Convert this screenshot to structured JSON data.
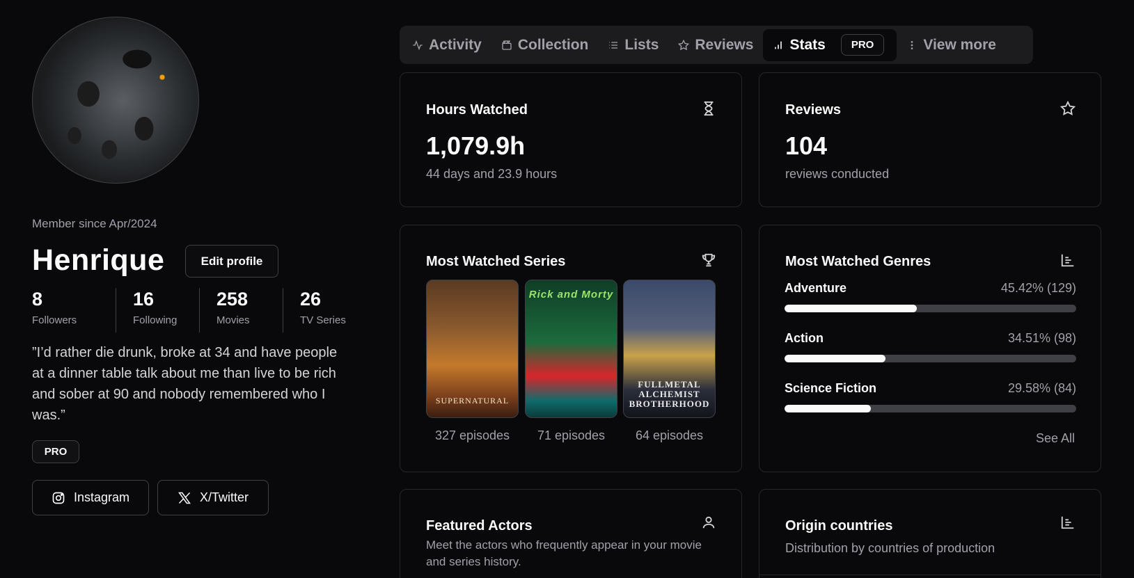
{
  "profile": {
    "member_since": "Member since Apr/2024",
    "name": "Henrique",
    "edit_label": "Edit profile",
    "stats": [
      {
        "value": "8",
        "label": "Followers"
      },
      {
        "value": "16",
        "label": "Following"
      },
      {
        "value": "258",
        "label": "Movies"
      },
      {
        "value": "26",
        "label": "TV Series"
      }
    ],
    "quote": "”I’d rather die drunk, broke at 34 and have people at a dinner table talk about me than live to be rich and sober at 90 and nobody remembered who I was.”",
    "badge": "PRO",
    "socials": [
      {
        "label": "Instagram",
        "icon": "instagram-icon"
      },
      {
        "label": "X/Twitter",
        "icon": "x-twitter-icon"
      }
    ]
  },
  "tabs": [
    {
      "label": "Activity",
      "icon": "activity-icon"
    },
    {
      "label": "Collection",
      "icon": "collection-icon"
    },
    {
      "label": "Lists",
      "icon": "list-icon"
    },
    {
      "label": "Reviews",
      "icon": "star-icon"
    },
    {
      "label": "Stats",
      "icon": "bar-chart-icon",
      "badge": "PRO",
      "active": true
    },
    {
      "label": "View more",
      "icon": "more-vertical-icon"
    }
  ],
  "hours": {
    "title": "Hours Watched",
    "value": "1,079.9h",
    "sub": "44 days and 23.9 hours",
    "icon": "hourglass-icon"
  },
  "reviews": {
    "title": "Reviews",
    "value": "104",
    "sub": "reviews conducted",
    "icon": "star-icon"
  },
  "series": {
    "title": "Most Watched Series",
    "icon": "trophy-icon",
    "items": [
      {
        "poster_text": "SUPERNATURAL",
        "episodes": "327 episodes"
      },
      {
        "poster_text": "Rick and Morty",
        "episodes": "71 episodes"
      },
      {
        "poster_text": "FULLMETAL ALCHEMIST BROTHERHOOD",
        "episodes": "64 episodes"
      }
    ]
  },
  "genres": {
    "title": "Most Watched Genres",
    "icon": "bar-chart-icon",
    "items": [
      {
        "name": "Adventure",
        "value": "45.42% (129)",
        "fraction": 0.4542
      },
      {
        "name": "Action",
        "value": "34.51% (98)",
        "fraction": 0.3451
      },
      {
        "name": "Science Fiction",
        "value": "29.58% (84)",
        "fraction": 0.2958
      }
    ],
    "see_all": "See All"
  },
  "actors": {
    "title": "Featured Actors",
    "sub": "Meet the actors who frequently appear in your movie and series history.",
    "icon": "user-icon"
  },
  "countries": {
    "title": "Origin countries",
    "sub": "Distribution by countries of production",
    "icon": "bar-chart-icon"
  }
}
